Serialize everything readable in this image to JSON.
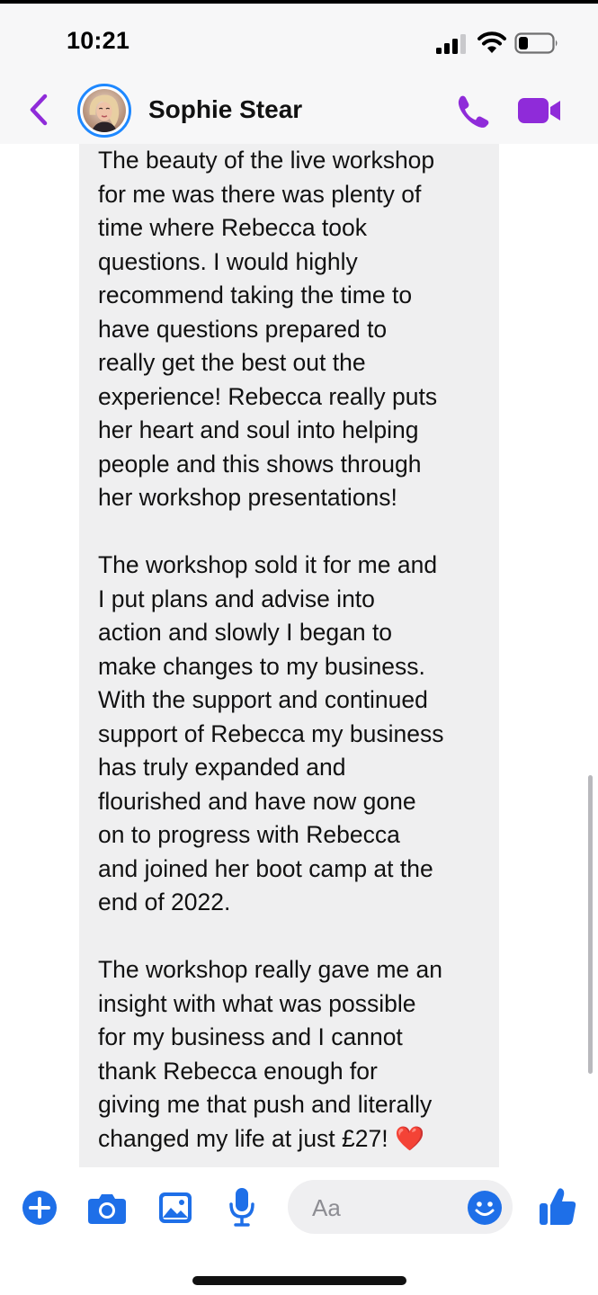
{
  "status_bar": {
    "time": "10:21"
  },
  "header": {
    "contact_name": "Sophie Stear"
  },
  "message": {
    "text": "The beauty of the live workshop\nfor me was there was plenty of\ntime where Rebecca took\nquestions. I would highly\nrecommend taking the time to\nhave questions prepared to\nreally get the best out the\nexperience! Rebecca really puts\nher heart and soul into helping\npeople and this shows through\nher workshop presentations!\n\nThe workshop sold it for me and\nI put plans and advise into\naction and slowly I began to\nmake changes to my business.\nWith the support and continued\nsupport of Rebecca my business\nhas truly expanded and\nflourished  and have now gone\non to progress with Rebecca\nand joined her boot camp at the\nend of 2022.\n\nThe workshop really gave me an\ninsight with what was possible\nfor my business and I cannot\nthank Rebecca enough for\ngiving me that push and literally\nchanged my life at just £27! ",
    "emoji": "❤️"
  },
  "composer": {
    "placeholder": "Aa"
  },
  "colors": {
    "accent": "#8f2bd9",
    "composer_blue": "#1e6fe8",
    "bubble": "#efeff0"
  },
  "icons": [
    "back-chevron-icon",
    "phone-icon",
    "video-camera-icon",
    "plus-icon",
    "camera-icon",
    "gallery-icon",
    "microphone-icon",
    "emoji-icon",
    "thumbs-up-icon",
    "cellular-signal-icon",
    "wifi-icon",
    "battery-icon"
  ]
}
